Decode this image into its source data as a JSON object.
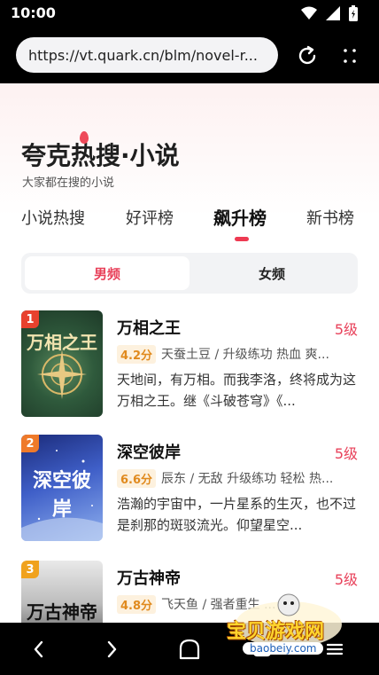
{
  "status": {
    "time": "10:00"
  },
  "browser": {
    "url": "https://vt.quark.cn/blm/novel-r..."
  },
  "brand": {
    "title": "夸克热搜·小说",
    "subtitle": "大家都在搜的小说"
  },
  "tabs": [
    {
      "label": "小说热搜"
    },
    {
      "label": "好评榜"
    },
    {
      "label": "飙升榜"
    },
    {
      "label": "新书榜"
    }
  ],
  "segment": {
    "male": "男频",
    "female": "女频"
  },
  "books": [
    {
      "rank": "1",
      "title": "万相之王",
      "level": "5级",
      "score": "4.2分",
      "meta": "天蚕土豆 / 升级练功 热血 爽...",
      "desc": "天地间，有万相。而我李洛，终将成为这万相之王。继《斗破苍穹》《...",
      "cover_text": "万相之王"
    },
    {
      "rank": "2",
      "title": "深空彼岸",
      "level": "5级",
      "score": "6.6分",
      "meta": "辰东 / 无敌 升级练功 轻松 热...",
      "desc": "浩瀚的宇宙中，一片星系的生灭，也不过是刹那的斑驳流光。仰望星空...",
      "cover_text": "深空彼岸"
    },
    {
      "rank": "3",
      "title": "万古神帝",
      "level": "5级",
      "score": "4.8分",
      "meta": "飞天鱼 / 强者重生 ...",
      "desc": "",
      "cover_text": "万古神帝"
    }
  ],
  "watermark": {
    "text": "宝贝游戏网",
    "url": "baobeiy.com"
  },
  "colors": {
    "accent": "#e8415a",
    "score": "#e08a1e"
  }
}
